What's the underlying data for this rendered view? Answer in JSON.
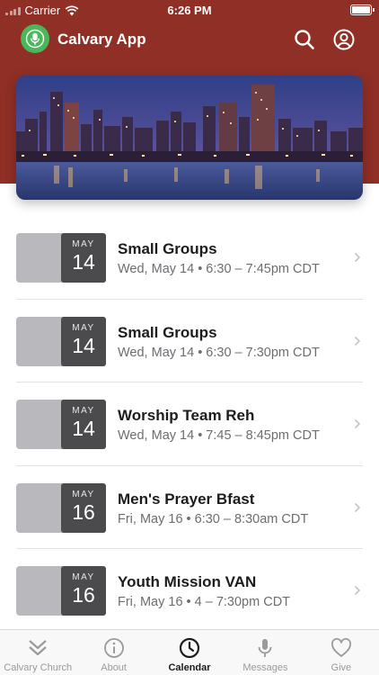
{
  "status_bar": {
    "carrier": "Carrier",
    "time": "6:26 PM"
  },
  "app": {
    "title": "Calvary App",
    "header_color": "#8f2f26",
    "logo_color": "#49b85a"
  },
  "banner": {
    "icon": "city-skyline-image"
  },
  "events": [
    {
      "month": "MAY",
      "day": "14",
      "title": "Small Groups",
      "time": "Wed, May 14 • 6:30 – 7:45pm CDT"
    },
    {
      "month": "MAY",
      "day": "14",
      "title": "Small Groups",
      "time": "Wed, May 14 • 6:30 – 7:30pm CDT"
    },
    {
      "month": "MAY",
      "day": "14",
      "title": "Worship Team Reh",
      "time": "Wed, May 14 • 7:45 – 8:45pm CDT"
    },
    {
      "month": "MAY",
      "day": "16",
      "title": "Men's Prayer Bfast",
      "time": "Fri, May 16 • 6:30 – 8:30am CDT"
    },
    {
      "month": "MAY",
      "day": "16",
      "title": "Youth Mission VAN",
      "time": "Fri, May 16 • 4 – 7:30pm CDT"
    }
  ],
  "tabs": [
    {
      "label": "Calvary Church",
      "icon": "double-chevron-down-icon",
      "active": false
    },
    {
      "label": "About",
      "icon": "info-icon",
      "active": false
    },
    {
      "label": "Calendar",
      "icon": "clock-icon",
      "active": true
    },
    {
      "label": "Messages",
      "icon": "microphone-icon",
      "active": false
    },
    {
      "label": "Give",
      "icon": "heart-icon",
      "active": false
    }
  ]
}
